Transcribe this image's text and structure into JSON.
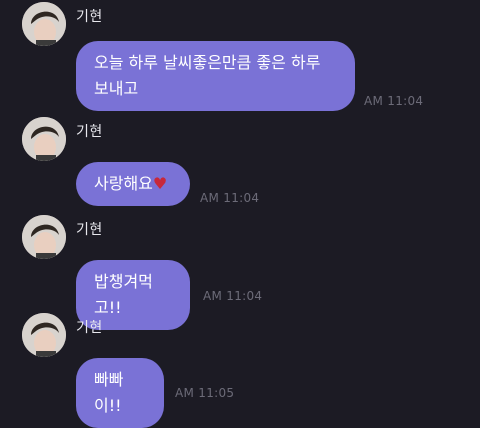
{
  "messages": [
    {
      "sender": "기현",
      "text": "오늘 하루 날씨좋은만큼 좋은 하루 보내고",
      "time": "AM 11:04"
    },
    {
      "sender": "기현",
      "text": "사랑해요",
      "emoji": "♥",
      "time": "AM 11:04"
    },
    {
      "sender": "기현",
      "text": "밥챙겨먹고!!",
      "time": "AM 11:04"
    },
    {
      "sender": "기현",
      "text": "빠빠이!!",
      "time": "AM 11:05"
    }
  ],
  "colors": {
    "background": "#1c1b24",
    "bubble": "#7a72d6",
    "timestamp": "#6c6b78",
    "heart": "#c8283a"
  }
}
